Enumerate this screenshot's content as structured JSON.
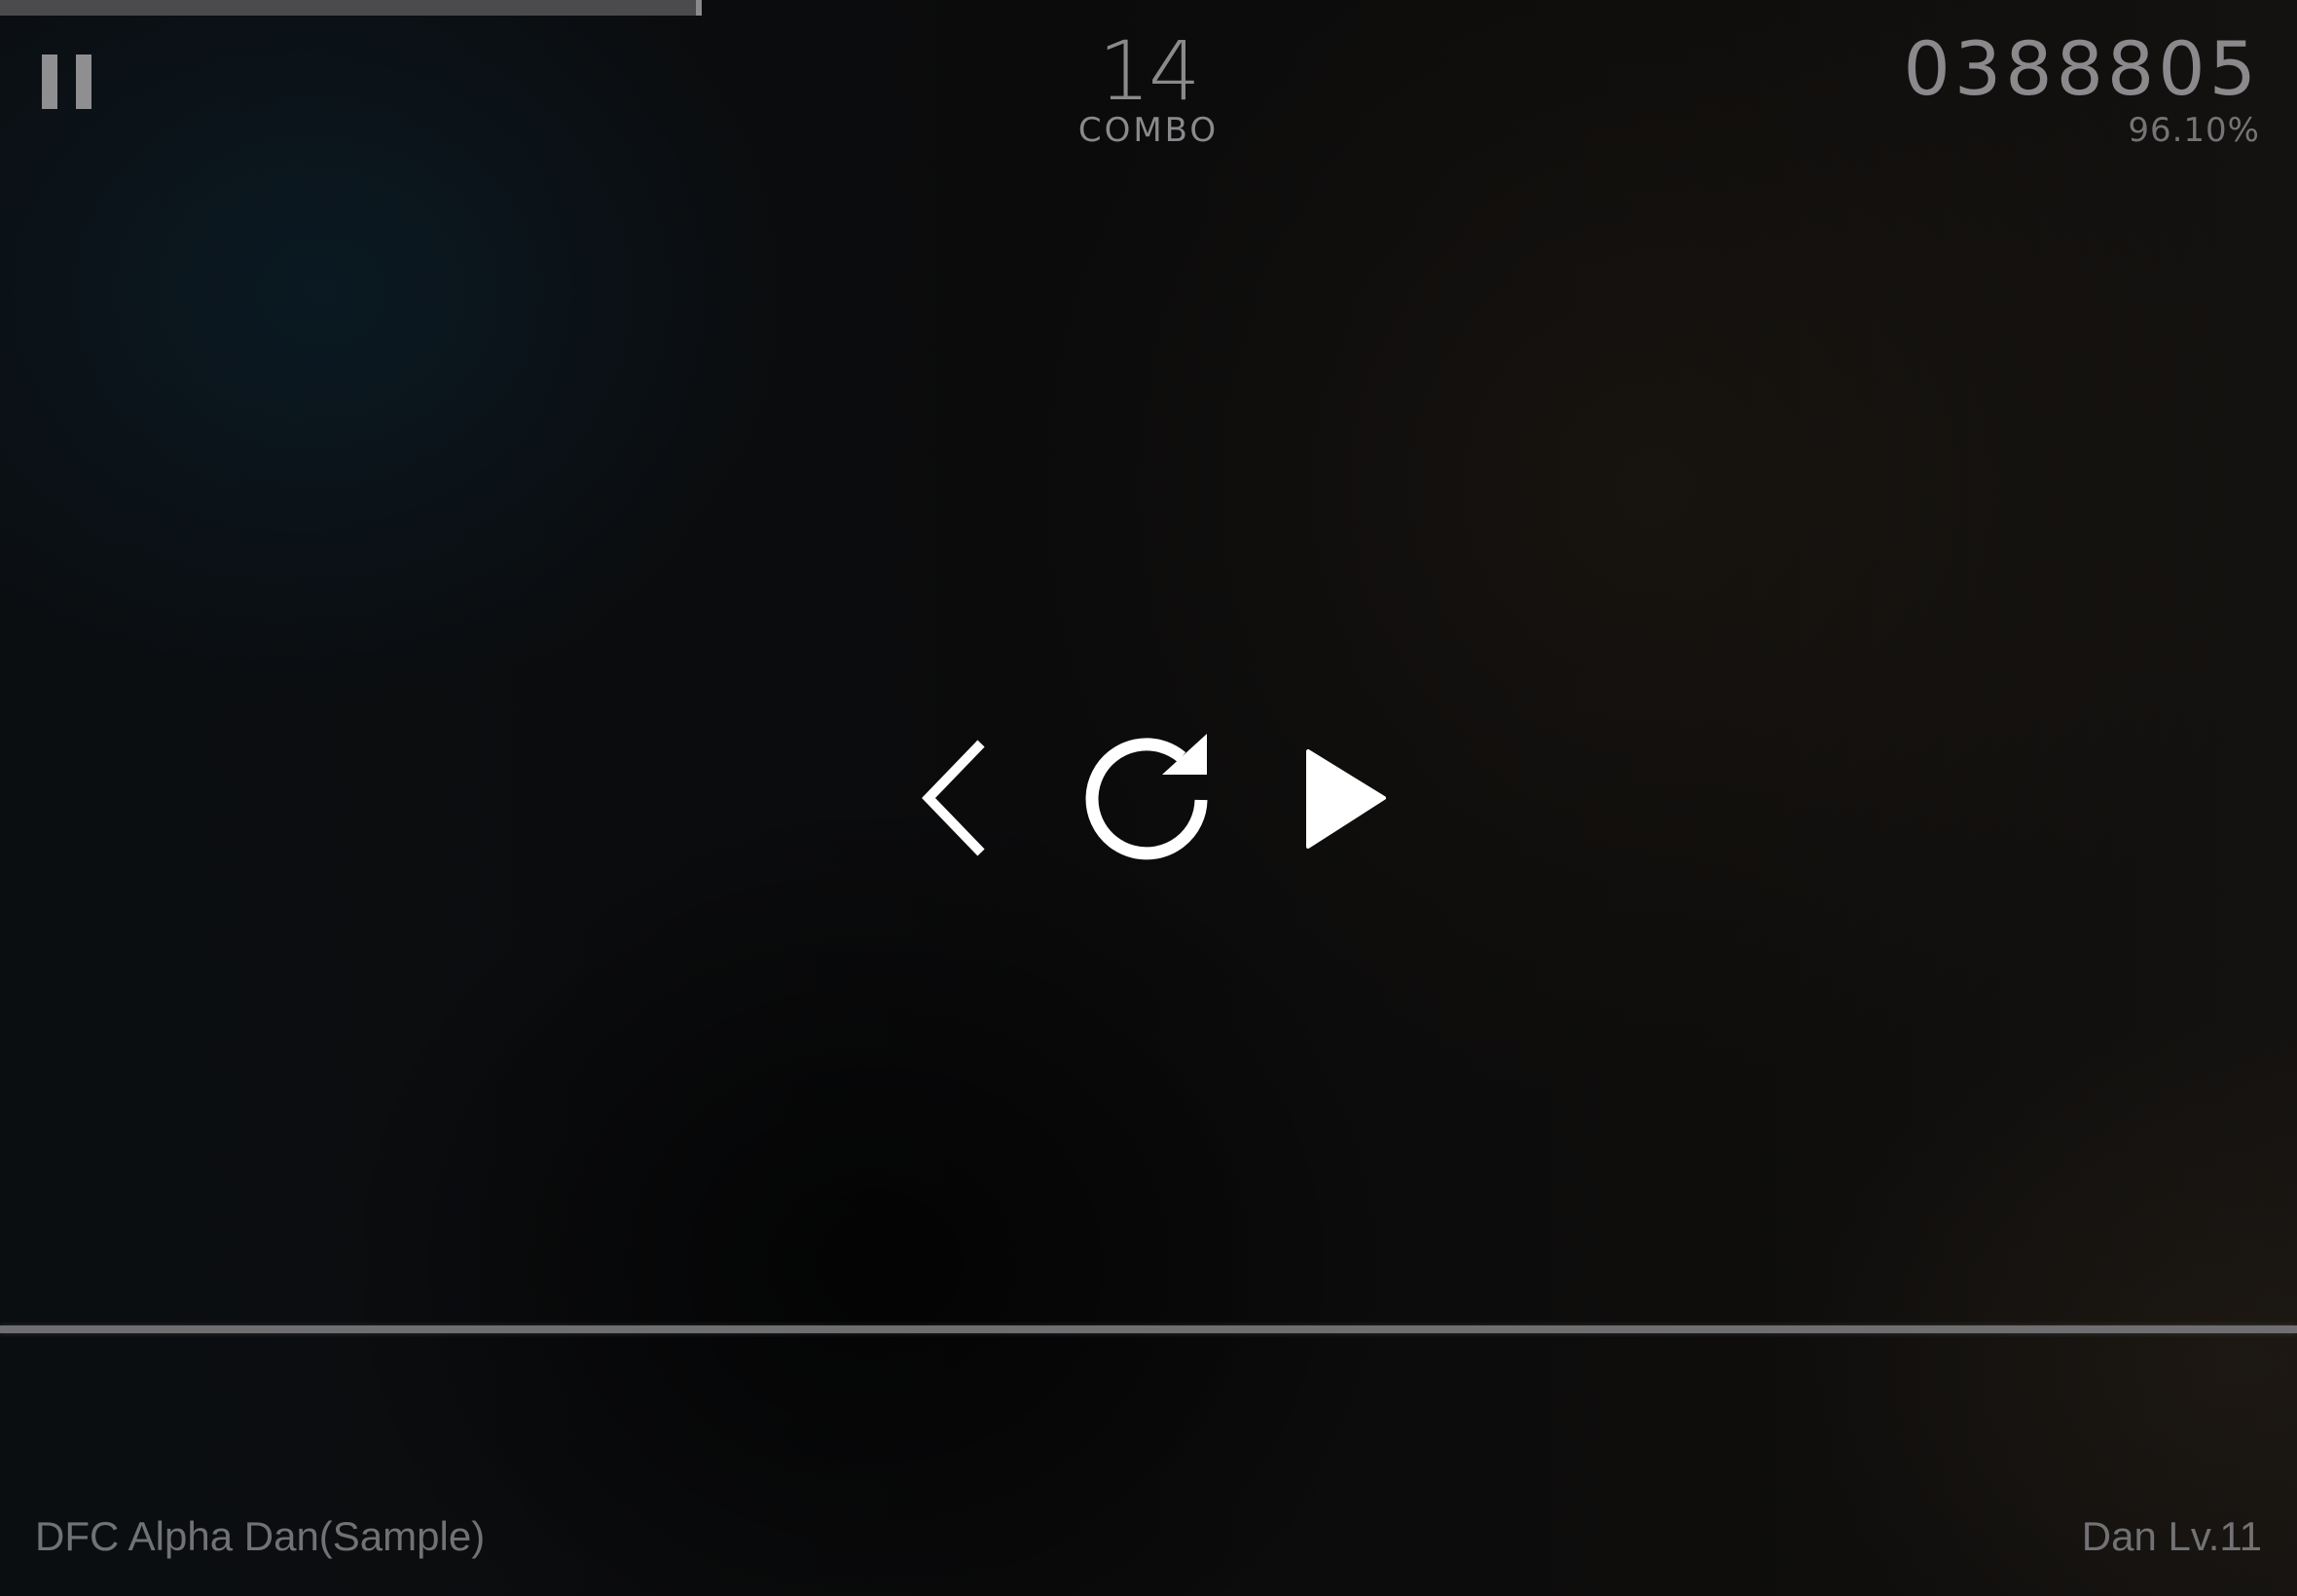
{
  "hud": {
    "song_progress_percent": 30.3,
    "combo": {
      "count": "14",
      "label": "COMBO"
    },
    "score": "0388805",
    "accuracy": "96.10%"
  },
  "pause_menu": {
    "icons": {
      "back": "chevron-left-icon",
      "restart": "restart-icon",
      "resume": "play-icon"
    }
  },
  "footer": {
    "song_title": "DFC Alpha Dan(Sample)",
    "difficulty": "Dan Lv.11"
  },
  "colors": {
    "hud_text": "#8a8a8c",
    "icon": "#ffffff",
    "judge_line": "#6f6f71",
    "progress": "#4b4b4d"
  }
}
